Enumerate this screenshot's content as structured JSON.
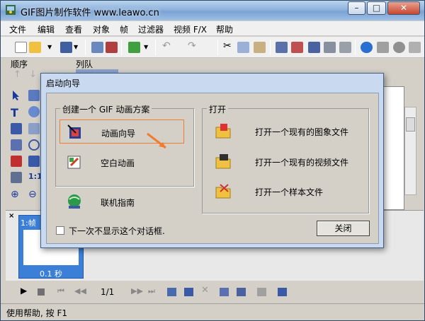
{
  "window": {
    "title": "GIF图片制作软件 www.leawo.cn",
    "controls": {
      "minimize": "–",
      "maximize": "□",
      "close": "✕"
    }
  },
  "menu": [
    "文件",
    "编辑",
    "查看",
    "对象",
    "帧",
    "过滤器",
    "视频 F/X",
    "帮助"
  ],
  "strip": {
    "order_label": "顺序",
    "list_label": "列队"
  },
  "dialog": {
    "title": "启动向导",
    "create_group": "创建一个 GIF 动画方案",
    "animation_wizard": "动画向导",
    "blank_animation": "空白动画",
    "online_guide": "联机指南",
    "open_group": "打开",
    "open_image": "打开一个现有的图象文件",
    "open_video": "打开一个现有的视频文件",
    "open_sample": "打开一个样本文件",
    "no_show_again": "下一次不显示这个对话框.",
    "close_button": "关闭"
  },
  "frames": [
    {
      "header": "1:帧",
      "duration": "0.1 秒"
    }
  ],
  "playback": {
    "counter": "1/1"
  },
  "statusbar": {
    "text": "使用帮助, 按 F1"
  },
  "colors": {
    "accent": "#3c7fd8",
    "highlight": "#f07c30",
    "titlebar": "#8fb2dc"
  }
}
